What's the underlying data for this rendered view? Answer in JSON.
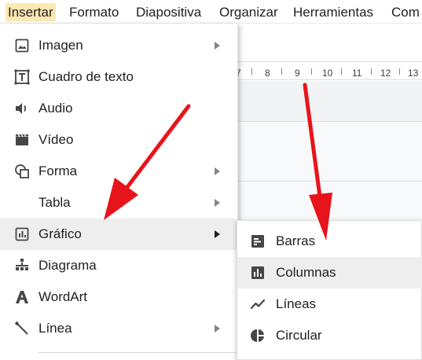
{
  "menubar": {
    "items": [
      {
        "label": "Insertar"
      },
      {
        "label": "Formato"
      },
      {
        "label": "Diapositiva"
      },
      {
        "label": "Organizar"
      },
      {
        "label": "Herramientas"
      },
      {
        "label": "Com"
      }
    ],
    "active_color": "#fce8b2"
  },
  "ruler": {
    "ticks": [
      "7",
      "8",
      "9",
      "10",
      "11",
      "12",
      "13"
    ]
  },
  "insert_menu": {
    "items": [
      {
        "label": "Imagen",
        "icon": "image-icon",
        "submenu": true
      },
      {
        "label": "Cuadro de texto",
        "icon": "text-box-icon",
        "submenu": false
      },
      {
        "label": "Audio",
        "icon": "audio-icon",
        "submenu": false
      },
      {
        "label": "Vídeo",
        "icon": "video-icon",
        "submenu": false
      },
      {
        "label": "Forma",
        "icon": "shape-icon",
        "submenu": true
      },
      {
        "label": "Tabla",
        "icon": "",
        "submenu": true
      },
      {
        "label": "Gráfico",
        "icon": "chart-icon",
        "submenu": true,
        "highlighted": true
      },
      {
        "label": "Diagrama",
        "icon": "diagram-icon",
        "submenu": false
      },
      {
        "label": "WordArt",
        "icon": "wordart-icon",
        "submenu": false
      },
      {
        "label": "Línea",
        "icon": "line-icon",
        "submenu": true
      }
    ],
    "hover_color": "#eeeeee"
  },
  "chart_submenu": {
    "items": [
      {
        "label": "Barras",
        "icon": "bar-chart-icon"
      },
      {
        "label": "Columnas",
        "icon": "column-chart-icon",
        "highlighted": true
      },
      {
        "label": "Líneas",
        "icon": "line-chart-icon"
      },
      {
        "label": "Circular",
        "icon": "pie-chart-icon"
      }
    ]
  },
  "annotation": {
    "arrow_color": "#e8141b"
  }
}
